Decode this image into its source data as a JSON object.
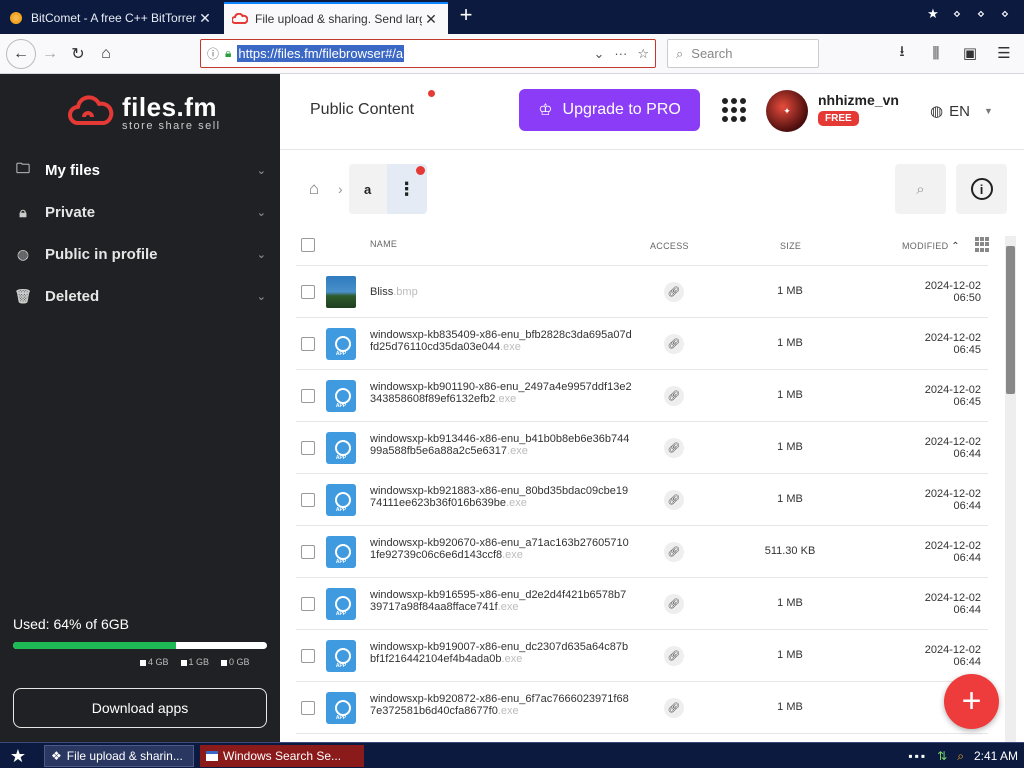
{
  "browser": {
    "tabs": [
      {
        "title": "BitComet - A free C++ BitTorrent/",
        "active": false
      },
      {
        "title": "File upload & sharing. Send large f",
        "active": true
      }
    ],
    "url": "https://files.fm/filebrowser#/a",
    "search_placeholder": "Search"
  },
  "sidebar": {
    "logo_name": "files.fm",
    "logo_sub": "store  share  sell",
    "items": [
      {
        "label": "My files",
        "icon": "folder-icon"
      },
      {
        "label": "Private",
        "icon": "lock-icon"
      },
      {
        "label": "Public in profile",
        "icon": "globe-icon"
      },
      {
        "label": "Deleted",
        "icon": "trash-icon"
      }
    ],
    "usage_text": "Used: 64% of 6GB",
    "usage_fraction": 0.64,
    "legend": [
      "4 GB",
      "1 GB",
      "0 GB"
    ],
    "download_apps": "Download apps"
  },
  "header": {
    "public_content": "Public Content",
    "upgrade": "Upgrade to PRO",
    "username": "nhhizme_vn",
    "plan_badge": "FREE",
    "language": "EN"
  },
  "breadcrumb": {
    "folder": "a"
  },
  "table": {
    "columns": {
      "name": "NAME",
      "access": "ACCESS",
      "size": "SIZE",
      "modified": "MODIFIED"
    },
    "rows": [
      {
        "name": "Bliss",
        "ext": ".bmp",
        "type": "image",
        "size": "1 MB",
        "date": "2024-12-02",
        "time": "06:50"
      },
      {
        "name": "windowsxp-kb835409-x86-enu_bfb2828c3da695a07dfd25d76110cd35da03e044",
        "ext": ".exe",
        "type": "app",
        "size": "1 MB",
        "date": "2024-12-02",
        "time": "06:45"
      },
      {
        "name": "windowsxp-kb901190-x86-enu_2497a4e9957ddf13e2343858608f89ef6132efb2",
        "ext": ".exe",
        "type": "app",
        "size": "1 MB",
        "date": "2024-12-02",
        "time": "06:45"
      },
      {
        "name": "windowsxp-kb913446-x86-enu_b41b0b8eb6e36b74499a588fb5e6a88a2c5e6317",
        "ext": ".exe",
        "type": "app",
        "size": "1 MB",
        "date": "2024-12-02",
        "time": "06:44"
      },
      {
        "name": "windowsxp-kb921883-x86-enu_80bd35bdac09cbe1974111ee623b36f016b639be",
        "ext": ".exe",
        "type": "app",
        "size": "1 MB",
        "date": "2024-12-02",
        "time": "06:44"
      },
      {
        "name": "windowsxp-kb920670-x86-enu_a71ac163b276057101fe92739c06c6e6d143ccf8",
        "ext": ".exe",
        "type": "app",
        "size": "511.30 KB",
        "date": "2024-12-02",
        "time": "06:44"
      },
      {
        "name": "windowsxp-kb916595-x86-enu_d2e2d4f421b6578b739717a98f84aa8fface741f",
        "ext": ".exe",
        "type": "app",
        "size": "1 MB",
        "date": "2024-12-02",
        "time": "06:44"
      },
      {
        "name": "windowsxp-kb919007-x86-enu_dc2307d635a64c87bbf1f216442104ef4b4ada0b",
        "ext": ".exe",
        "type": "app",
        "size": "1 MB",
        "date": "2024-12-02",
        "time": "06:44"
      },
      {
        "name": "windowsxp-kb920872-x86-enu_6f7ac7666023971f687e372581b6d40cfa8677f0",
        "ext": ".exe",
        "type": "app",
        "size": "1 MB",
        "date": "2024",
        "time": ""
      }
    ]
  },
  "taskbar": {
    "tasks": [
      "File upload & sharin...",
      "Windows Search Se..."
    ],
    "clock": "2:41 AM"
  }
}
